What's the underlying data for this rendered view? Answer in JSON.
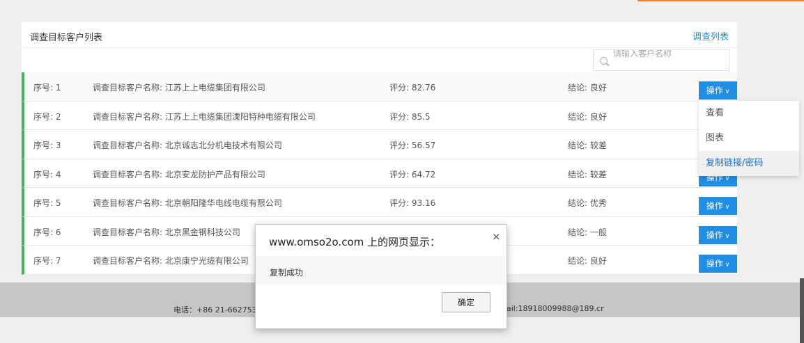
{
  "panel": {
    "title": "调查目标客户列表",
    "link": "调查列表"
  },
  "search": {
    "placeholder": "请输入客户名称"
  },
  "rows": [
    {
      "seq": "序号: 1",
      "name": "调查目标客户名称: 江苏上上电缆集团有限公司",
      "score": "评分: 82.76",
      "conclusion": "结论: 良好",
      "action": "操作"
    },
    {
      "seq": "序号: 2",
      "name": "调查目标客户名称: 江苏上上电缆集团溧阳特种电缆有限公司",
      "score": "评分: 85.5",
      "conclusion": "结论: 良好",
      "action": "操作"
    },
    {
      "seq": "序号: 3",
      "name": "调查目标客户名称: 北京诚志北分机电技术有限公司",
      "score": "评分: 56.57",
      "conclusion": "结论: 较差",
      "action": "操作"
    },
    {
      "seq": "序号: 4",
      "name": "调查目标客户名称: 北京安龙防护产品有限公司",
      "score": "评分: 64.72",
      "conclusion": "结论: 较差",
      "action": "操作"
    },
    {
      "seq": "序号: 5",
      "name": "调查目标客户名称: 北京朝阳隆华电线电缆有限公司",
      "score": "评分: 93.16",
      "conclusion": "结论: 优秀",
      "action": "操作"
    },
    {
      "seq": "序号: 6",
      "name": "调查目标客户名称: 北京黑金钢科技公司",
      "score": "",
      "conclusion": "结论: 一般",
      "action": "操作"
    },
    {
      "seq": "序号: 7",
      "name": "调查目标客户名称: 北京康宁光缆有限公司",
      "score": "",
      "conclusion": "结论: 良好",
      "action": "操作"
    }
  ],
  "dropdown": {
    "items": [
      "查看",
      "图表",
      "复制链接/密码"
    ]
  },
  "footer": {
    "tel": "电话：+86 21-66275333",
    "email": "ail:18918009988@189.cn"
  },
  "dialog": {
    "title": "www.omso2o.com 上的网页显示：",
    "close": "×",
    "message": "复制成功",
    "ok": "确定"
  },
  "colors": {
    "accent": "#1e8ee6",
    "row_marker": "#47b25d",
    "top_accent": "#f07e2b"
  }
}
